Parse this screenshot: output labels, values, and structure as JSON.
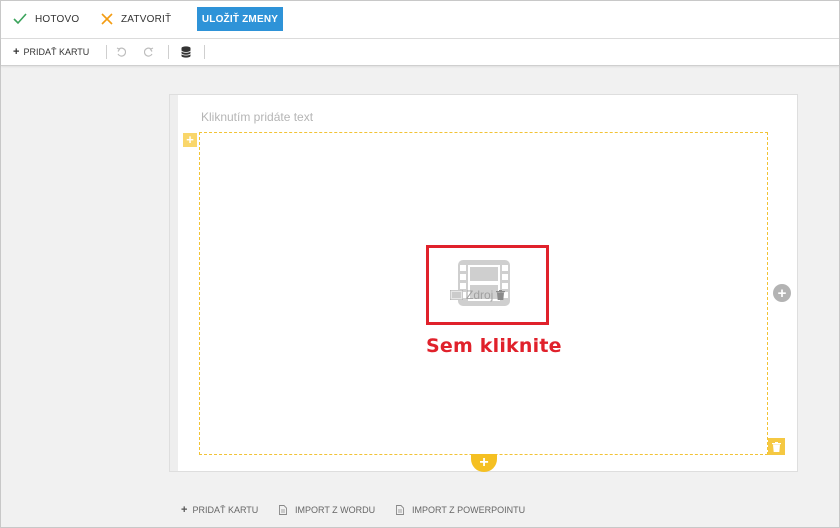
{
  "topbar": {
    "done_label": "HOTOVO",
    "close_label": "ZATVORIŤ",
    "save_label": "ULOŽIŤ ZMENY"
  },
  "toolbar": {
    "add_card_label": "PRIDAŤ KARTU"
  },
  "editor": {
    "text_placeholder": "Kliknutím pridáte text",
    "media_source_label": "Zdroj",
    "click_hint": "Sem kliknite"
  },
  "footer": {
    "add_card_label": "PRIDAŤ KARTU",
    "import_word_label": "IMPORT Z WORDU",
    "import_powerpoint_label": "IMPORT Z POWERPOINTU"
  },
  "icons": {
    "done": "check-icon",
    "close": "close-icon",
    "undo": "undo-icon",
    "redo": "redo-icon",
    "database": "database-icon",
    "video": "video-icon",
    "trash": "trash-icon",
    "document": "document-icon"
  },
  "colors": {
    "accent_blue": "#2e93d8",
    "done_green": "#3aa35b",
    "close_orange": "#f39c12",
    "frame_yellow": "#f2c335",
    "highlight_red": "#e0212b"
  }
}
